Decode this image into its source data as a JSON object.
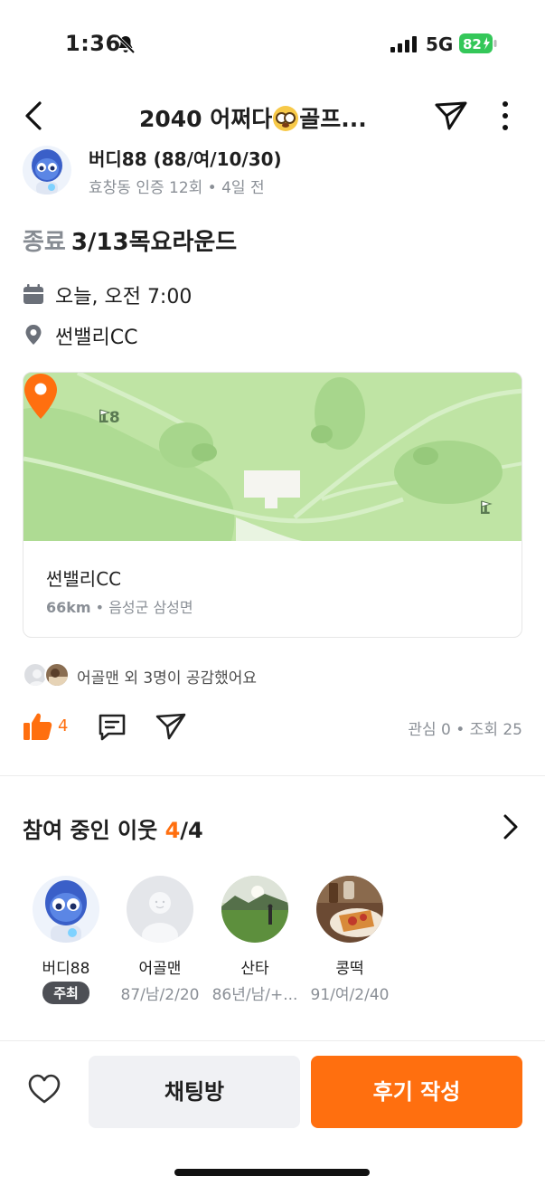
{
  "status_bar": {
    "time": "1:36",
    "network": "5G",
    "battery": "82"
  },
  "header": {
    "title_prefix": "2040 어쩌다",
    "title_suffix": "골프...",
    "emoji": "flushed-face"
  },
  "author": {
    "name": "버디88 (88/여/10/30)",
    "meta": "효창동 인증 12회 • 4일 전"
  },
  "event": {
    "status": "종료",
    "title": "3/13목요라운드",
    "time": "오늘, 오전 7:00",
    "place": "썬밸리CC"
  },
  "map": {
    "flag_labels": [
      "18",
      "1"
    ],
    "place_name": "썬밸리CC",
    "distance": "66km",
    "address": "• 음성군 삼성면"
  },
  "likes": {
    "text": "어골맨 외 3명이 공감했어요",
    "count": "4"
  },
  "stats": {
    "text": "관심 0 • 조회 25"
  },
  "participants": {
    "title": "참여 중인 이웃",
    "current": "4",
    "total": "/4",
    "people": [
      {
        "name": "버디88",
        "meta": "주최",
        "is_host": true
      },
      {
        "name": "어골맨",
        "meta": "87/남/2/20",
        "is_host": false
      },
      {
        "name": "산타",
        "meta": "86년/남/+...",
        "is_host": false
      },
      {
        "name": "콩떡",
        "meta": "91/여/2/40",
        "is_host": false
      }
    ]
  },
  "bottom": {
    "chat_label": "채팅방",
    "review_label": "후기 작성"
  },
  "colors": {
    "accent": "#ff6f0f",
    "map_green": "#bfe4a4",
    "battery_green": "#34c759"
  },
  "icons": [
    "bell-off-icon",
    "signal-icon",
    "battery-icon",
    "back-icon",
    "share-icon",
    "more-icon",
    "calendar-icon",
    "location-icon",
    "map-pin-icon",
    "flag-icon",
    "thumbs-up-icon",
    "comment-icon",
    "send-icon",
    "chevron-right-icon",
    "heart-icon"
  ]
}
